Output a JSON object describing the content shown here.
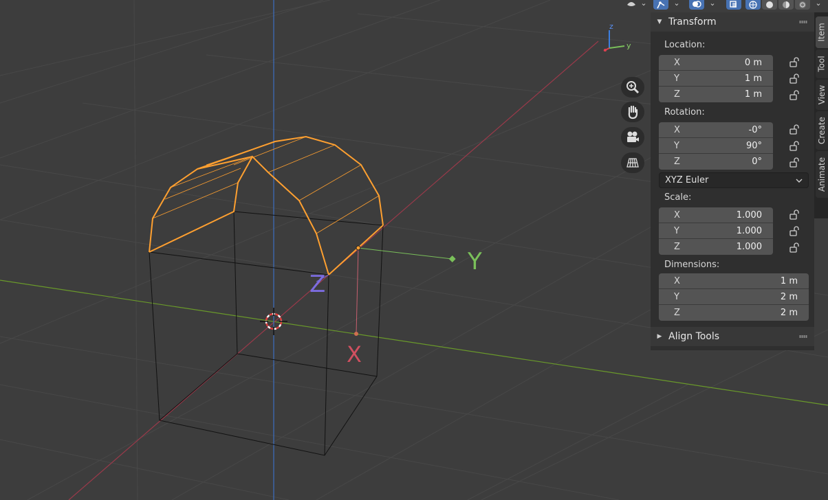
{
  "viewport": {
    "gizmo_labels": {
      "z": "z",
      "y": "y"
    },
    "object_axis_labels": {
      "y": "Y",
      "z": "Z",
      "x": "X"
    }
  },
  "colors": {
    "background": "#3d3d3d",
    "grid": "#474747",
    "axis_x": "#9a3a4a",
    "axis_y": "#6a9a2a",
    "axis_z": "#3c6fc0",
    "selection": "#ffa030",
    "accent": "#4772b3"
  },
  "header": {
    "icons": [
      "editor-type-icon",
      "pivot-icon",
      "overlay-icon",
      "xray-icon",
      "wireframe-shading-icon",
      "solid-shading-icon",
      "material-shading-icon",
      "rendered-shading-icon"
    ]
  },
  "navigation": {
    "buttons": [
      "zoom-icon",
      "pan-hand-icon",
      "camera-icon",
      "perspective-grid-icon"
    ]
  },
  "sidebar": {
    "transform": {
      "title": "Transform",
      "location": {
        "label": "Location:",
        "x": {
          "label": "X",
          "value": "0 m"
        },
        "y": {
          "label": "Y",
          "value": "1 m"
        },
        "z": {
          "label": "Z",
          "value": "1 m"
        }
      },
      "rotation": {
        "label": "Rotation:",
        "x": {
          "label": "X",
          "value": "-0°"
        },
        "y": {
          "label": "Y",
          "value": "90°"
        },
        "z": {
          "label": "Z",
          "value": "0°"
        }
      },
      "rotation_mode": "XYZ Euler",
      "scale": {
        "label": "Scale:",
        "x": {
          "label": "X",
          "value": "1.000"
        },
        "y": {
          "label": "Y",
          "value": "1.000"
        },
        "z": {
          "label": "Z",
          "value": "1.000"
        }
      },
      "dimensions": {
        "label": "Dimensions:",
        "x": {
          "label": "X",
          "value": "1 m"
        },
        "y": {
          "label": "Y",
          "value": "2 m"
        },
        "z": {
          "label": "Z",
          "value": "2 m"
        }
      }
    },
    "align_tools": {
      "title": "Align Tools"
    }
  },
  "tabs": [
    "Item",
    "Tool",
    "View",
    "Create",
    "Animate"
  ]
}
